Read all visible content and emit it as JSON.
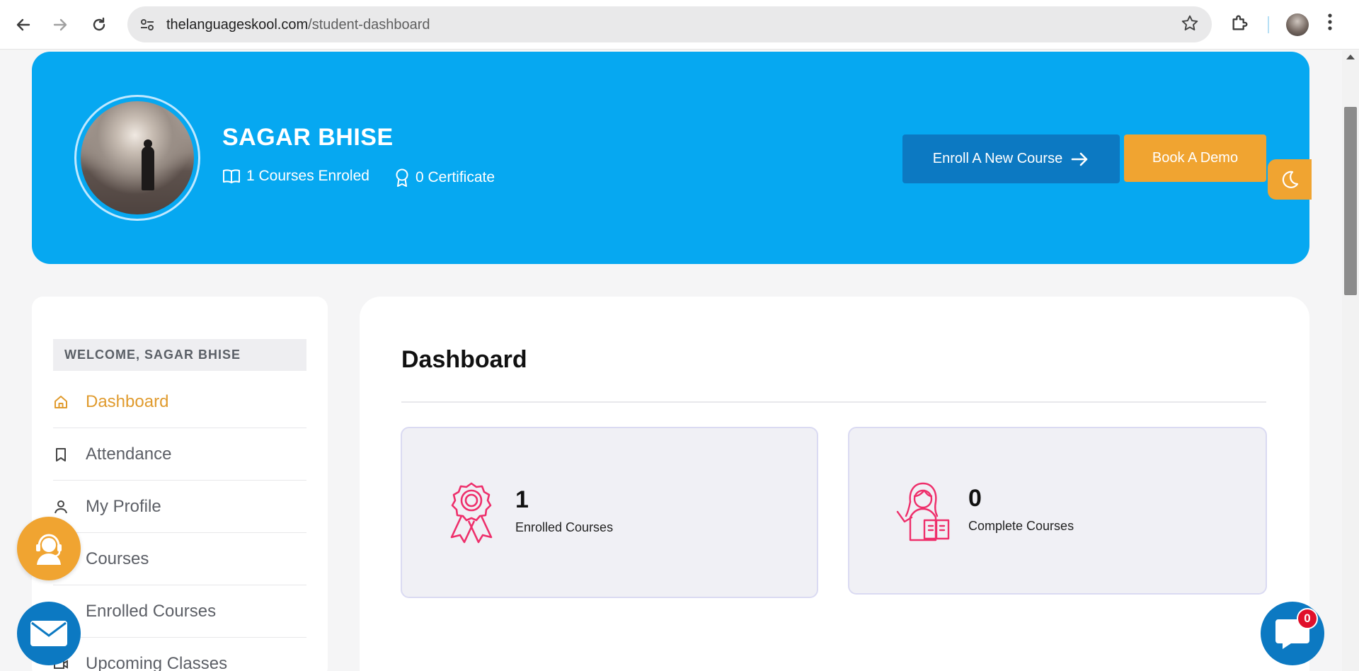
{
  "browser": {
    "url_host": "thelanguageskool.com",
    "url_path": "/student-dashboard"
  },
  "banner": {
    "user_name": "SAGAR BHISE",
    "courses_enrolled": "1 Courses Enroled",
    "certificates": "0 Certificate",
    "enroll_button": "Enroll A New Course",
    "demo_button": "Book A Demo"
  },
  "sidebar": {
    "welcome": "WELCOME, SAGAR BHISE",
    "items": [
      {
        "label": "Dashboard",
        "icon": "home-icon",
        "active": true
      },
      {
        "label": "Attendance",
        "icon": "bookmark-icon"
      },
      {
        "label": "My Profile",
        "icon": "user-icon"
      },
      {
        "label": "Courses",
        "icon": "book-icon"
      },
      {
        "label": "Enrolled Courses",
        "icon": "list-icon"
      },
      {
        "label": "Upcoming Classes",
        "icon": "video-icon"
      }
    ]
  },
  "main": {
    "title": "Dashboard",
    "cards": [
      {
        "value": "1",
        "label": "Enrolled Courses",
        "icon": "award-ribbon-icon"
      },
      {
        "value": "0",
        "label": "Complete Courses",
        "icon": "girl-reading-icon"
      }
    ]
  },
  "chat": {
    "badge_count": "0"
  },
  "colors": {
    "banner_blue": "#06a8f1",
    "primary_blue": "#0c79c2",
    "accent_orange": "#f0a431",
    "active_menu": "#e09b2e",
    "icon_pink": "#ee2f6b",
    "badge_red": "#e0102b"
  }
}
